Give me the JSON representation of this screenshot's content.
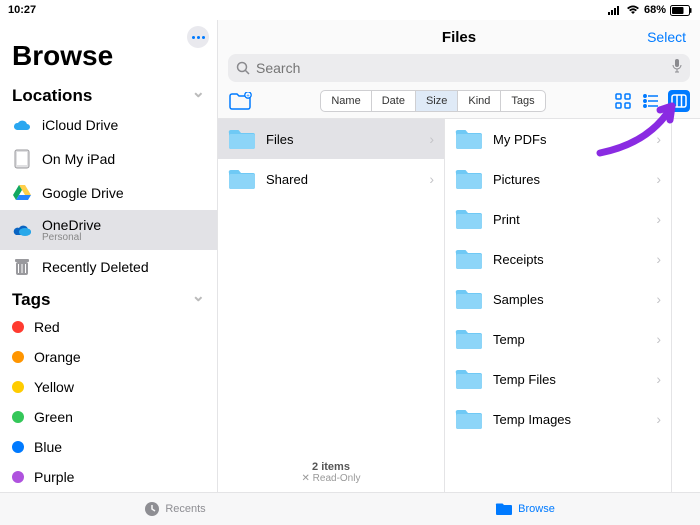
{
  "statusbar": {
    "time": "10:27",
    "battery": "68%"
  },
  "sidebar": {
    "title": "Browse",
    "sections": {
      "locations": {
        "header": "Locations",
        "items": [
          {
            "label": "iCloud Drive",
            "sub": "",
            "icon": "icloud"
          },
          {
            "label": "On My iPad",
            "sub": "",
            "icon": "ipad"
          },
          {
            "label": "Google Drive",
            "sub": "",
            "icon": "gdrive"
          },
          {
            "label": "OneDrive",
            "sub": "Personal",
            "icon": "onedrive",
            "selected": true
          },
          {
            "label": "Recently Deleted",
            "sub": "",
            "icon": "trash"
          }
        ]
      },
      "tags": {
        "header": "Tags",
        "items": [
          {
            "label": "Red",
            "color": "#ff3b30"
          },
          {
            "label": "Orange",
            "color": "#ff9500"
          },
          {
            "label": "Yellow",
            "color": "#ffcc00"
          },
          {
            "label": "Green",
            "color": "#34c759"
          },
          {
            "label": "Blue",
            "color": "#007aff"
          },
          {
            "label": "Purple",
            "color": "#af52de"
          }
        ]
      }
    }
  },
  "content": {
    "title": "Files",
    "select_label": "Select",
    "search_placeholder": "Search",
    "sort_options": [
      "Name",
      "Date",
      "Size",
      "Kind",
      "Tags"
    ],
    "sort_active": "Size",
    "view_active": "columns",
    "columns": [
      {
        "items": [
          {
            "name": "Files",
            "selected": true
          },
          {
            "name": "Shared"
          }
        ],
        "footer_count": "2 items",
        "footer_note": "Read-Only"
      },
      {
        "items": [
          {
            "name": "My PDFs"
          },
          {
            "name": "Pictures"
          },
          {
            "name": "Print"
          },
          {
            "name": "Receipts"
          },
          {
            "name": "Samples"
          },
          {
            "name": "Temp"
          },
          {
            "name": "Temp Files"
          },
          {
            "name": "Temp Images"
          }
        ]
      }
    ]
  },
  "tabbar": {
    "recents": "Recents",
    "browse": "Browse"
  }
}
